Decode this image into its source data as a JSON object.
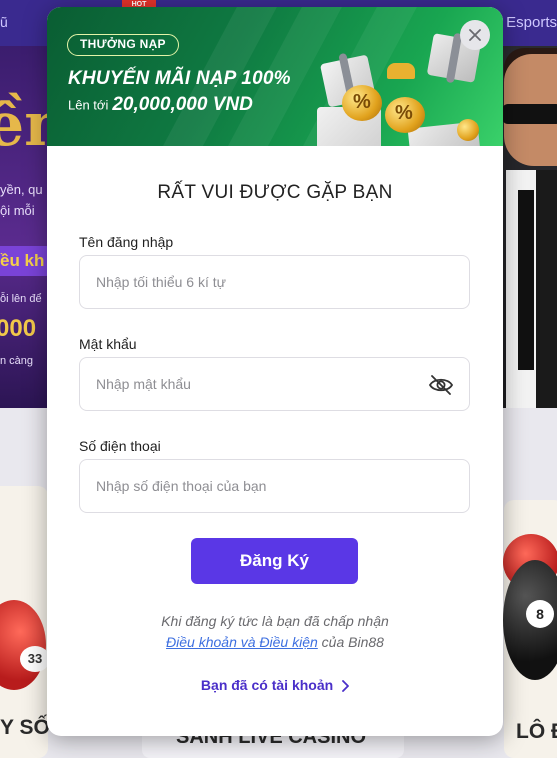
{
  "background": {
    "nav_left": "ũ",
    "nav_right": "Esports",
    "hot_badge": "HOT",
    "banner_big": "ền",
    "banner_line1": "yền, qu",
    "banner_line2": "ội mỗi",
    "banner_chip": "ều kh",
    "banner_line3": "ỗi lên để",
    "banner_num": "000",
    "banner_line4": "n càng",
    "ball_left_number": "33",
    "ball_right_number": "8",
    "label_left": "Y SỐ",
    "label_mid": "SẢNH LIVE CASINO",
    "label_right": "LÔ Đ"
  },
  "modal": {
    "promo": {
      "badge": "THƯỞNG NẠP",
      "title": "KHUYẾN MÃI NẠP 100%",
      "sub_prefix": "Lên tới",
      "sub_amount": "20,000,000 VND"
    },
    "heading": "RẤT VUI ĐƯỢC GẶP BẠN",
    "fields": {
      "username": {
        "label": "Tên đăng nhập",
        "value": "",
        "placeholder": "Nhập tối thiểu 6 kí tự"
      },
      "password": {
        "label": "Mật khẩu",
        "value": "",
        "placeholder": "Nhập mật khẩu"
      },
      "phone": {
        "label": "Số điện thoại",
        "value": "",
        "placeholder": "Nhập số điện thoại của bạn"
      }
    },
    "submit_label": "Đăng Ký",
    "terms": {
      "line1": "Khi đăng ký tức là bạn đã chấp nhận",
      "link": "Điều khoản và Điều kiện",
      "suffix": " của Bin88"
    },
    "login_prompt": "Bạn đã có tài khoản",
    "icons": {
      "close": "close-icon",
      "eye": "eye-off-icon",
      "chevron": "chevron-right-icon"
    }
  }
}
